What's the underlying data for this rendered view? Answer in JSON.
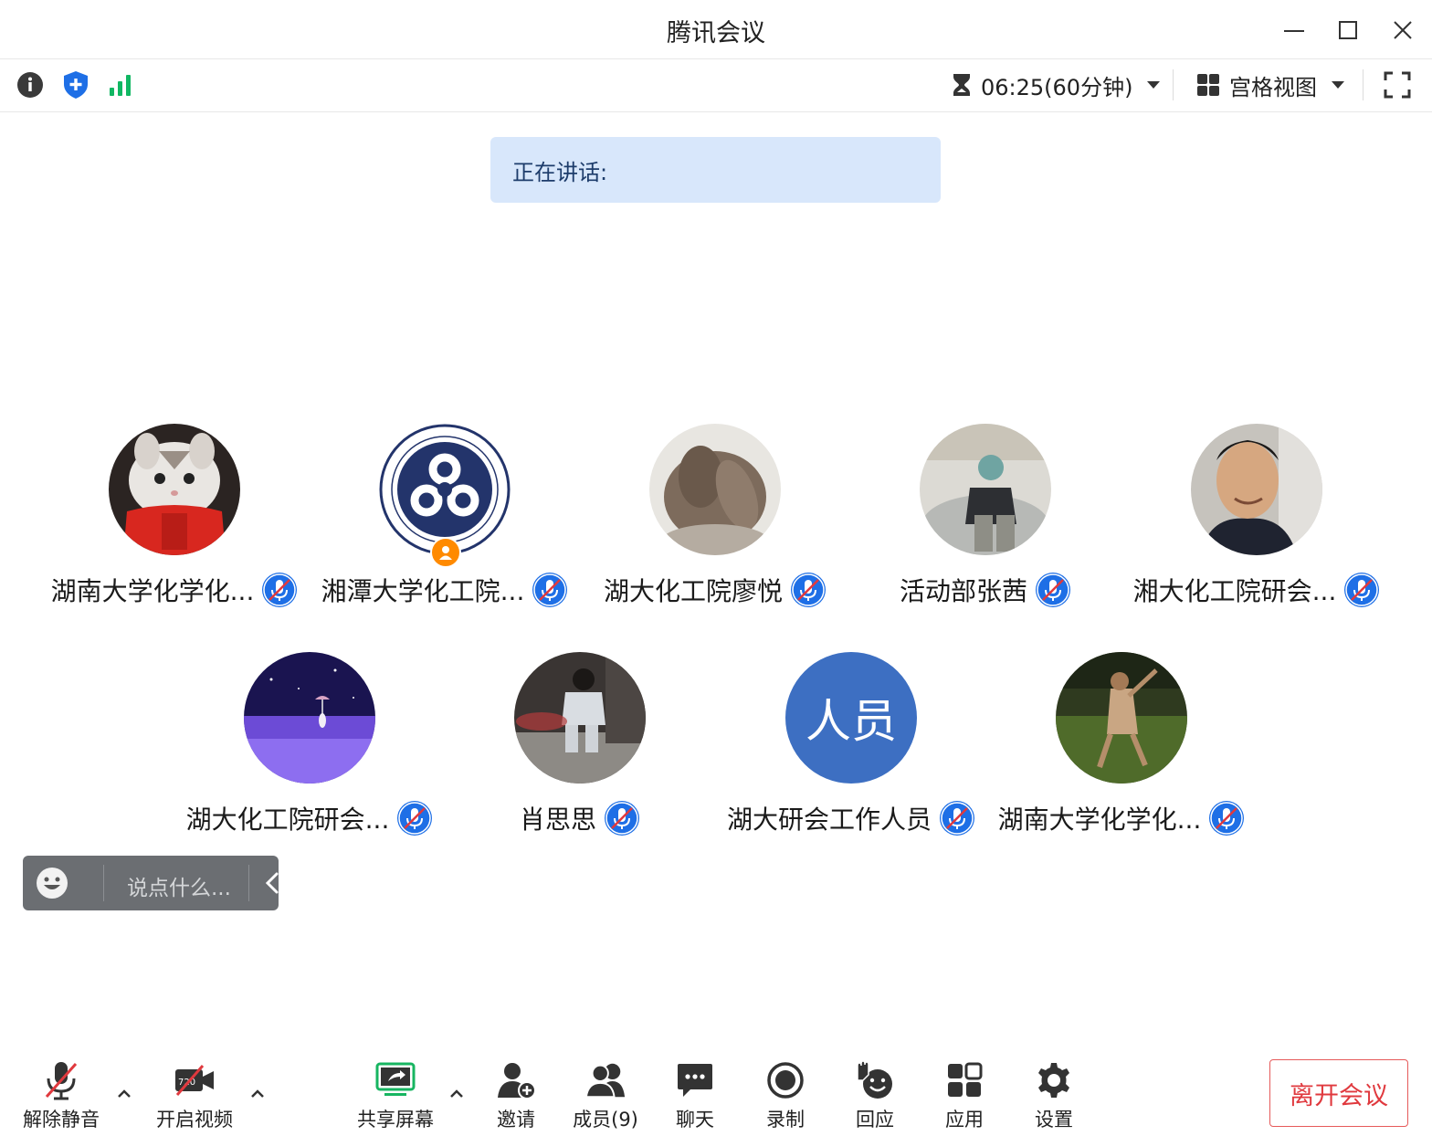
{
  "window": {
    "title": "腾讯会议",
    "controls": [
      "minimize-icon",
      "maximize-icon",
      "close-icon"
    ]
  },
  "toolbar": {
    "left_icons": [
      "info-icon",
      "security-shield-icon",
      "signal-icon"
    ],
    "timer": "06:25(60分钟)",
    "view_mode": "宫格视图"
  },
  "speaking": {
    "label": "正在讲话:"
  },
  "participants": [
    {
      "name": "湖南大学化学化...",
      "muted": true
    },
    {
      "name": "湘潭大学化工院...",
      "muted": true,
      "host": true
    },
    {
      "name": "湖大化工院廖悦",
      "muted": true
    },
    {
      "name": "活动部张茜",
      "muted": true
    },
    {
      "name": "湘大化工院研会...",
      "muted": true
    },
    {
      "name": "湖大化工院研会...",
      "muted": true
    },
    {
      "name": "肖思思",
      "muted": true
    },
    {
      "name": "湖大研会工作人员",
      "muted": true,
      "avatar_text": "人员"
    },
    {
      "name": "湖南大学化学化...",
      "muted": true
    }
  ],
  "chat": {
    "placeholder": "说点什么..."
  },
  "bottom": {
    "unmute": "解除静音",
    "start_video": "开启视频",
    "video_badge": "720",
    "share_screen": "共享屏幕",
    "invite": "邀请",
    "members": "成员(9)",
    "chat": "聊天",
    "record": "录制",
    "react": "回应",
    "apps": "应用",
    "settings": "设置",
    "leave": "离开会议"
  },
  "colors": {
    "accent_blue": "#1e6fe6",
    "muted_red": "#e0393e",
    "share_green": "#17b561",
    "signal_green": "#11b763",
    "speaking_bg": "#d8e7fb",
    "avatar_blue": "#3d6fc2"
  }
}
